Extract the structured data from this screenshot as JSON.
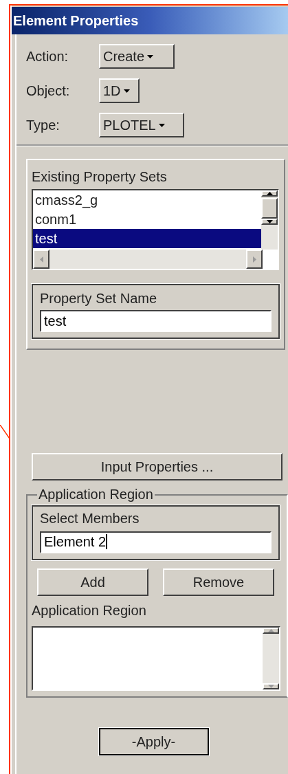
{
  "window": {
    "title": "Element Properties"
  },
  "selectors": [
    {
      "label": "Action:",
      "value": "Create"
    },
    {
      "label": "Object:",
      "value": "1D"
    },
    {
      "label": "Type:",
      "value": "PLOTEL"
    }
  ],
  "property_sets": {
    "title": "Existing Property Sets",
    "items": [
      {
        "label": "cmass2_g",
        "selected": false
      },
      {
        "label": "conm1",
        "selected": false
      },
      {
        "label": "test",
        "selected": true
      }
    ]
  },
  "property_set_name": {
    "label": "Property Set Name",
    "value": "test"
  },
  "input_properties_button": "Input Properties ...",
  "application_region": {
    "title": "Application Region",
    "select_members": {
      "label": "Select Members",
      "value": "Element 2"
    },
    "buttons": [
      "Add",
      "Remove"
    ],
    "list_label": "Application Region"
  },
  "apply_button": "-Apply-"
}
